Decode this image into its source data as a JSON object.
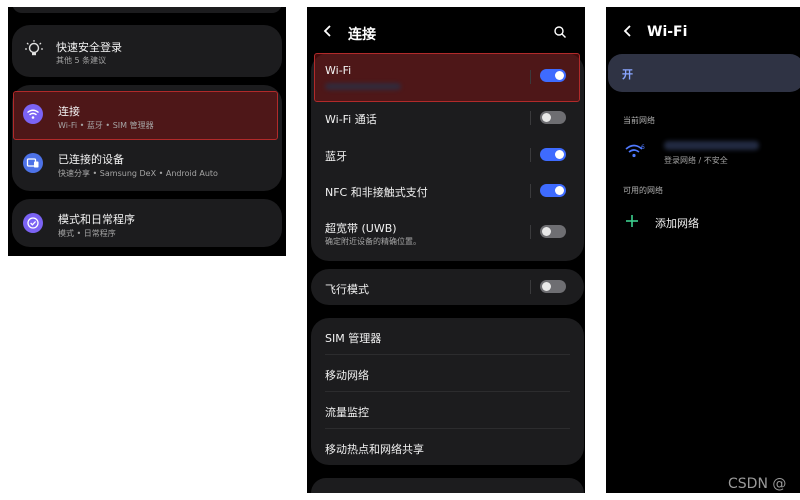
{
  "left_panel": {
    "quick_login": {
      "title": "快速安全登录",
      "subtitle": "其他 5 条建议"
    },
    "connections": {
      "title": "连接",
      "subtitle": "Wi-Fi • 蓝牙 • SIM 管理器"
    },
    "connected_devices": {
      "title": "已连接的设备",
      "subtitle": "快速分享 • Samsung DeX • Android Auto"
    },
    "modes_routines": {
      "title": "模式和日常程序",
      "subtitle": "模式 • 日常程序"
    }
  },
  "middle_panel": {
    "back_label": "连接",
    "items": {
      "wifi": {
        "label": "Wi-Fi",
        "on": true
      },
      "wifi_calling": {
        "label": "Wi-Fi 通话",
        "on": false
      },
      "bluetooth": {
        "label": "蓝牙",
        "on": true
      },
      "nfc": {
        "label": "NFC 和非接触式支付",
        "on": true
      },
      "uwb": {
        "label": "超宽带 (UWB)",
        "subtitle": "确定附近设备的精确位置。",
        "on": false
      },
      "airplane": {
        "label": "飞行模式",
        "on": false
      },
      "sim": {
        "label": "SIM 管理器"
      },
      "mobile": {
        "label": "移动网络"
      },
      "data_usage": {
        "label": "流量监控"
      },
      "hotspot": {
        "label": "移动热点和网络共享"
      }
    }
  },
  "right_panel": {
    "title": "Wi-Fi",
    "toggle_label": "开",
    "current_network_header": "当前网络",
    "current_network_status": "登录网络 / 不安全",
    "available_header": "可用的网络",
    "add_network": "添加网络"
  },
  "watermark": "CSDN @",
  "colors": {
    "accent": "#3e6bff",
    "highlight": "#b22a2a",
    "add_green": "#3ccf8e"
  }
}
